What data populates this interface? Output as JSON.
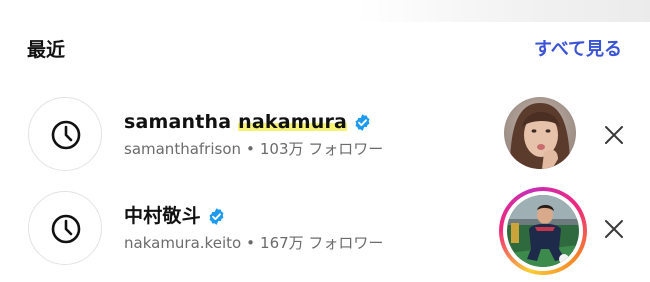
{
  "section": {
    "title": "最近",
    "see_all_label": "すべて見る"
  },
  "colors": {
    "accent_link": "#3b54d6",
    "verified_blue": "#1d9bf0",
    "secondary_text": "#6b6b6b",
    "highlight": "#f4f05a"
  },
  "recent": [
    {
      "name_part1": "samantha ",
      "name_part2": "nakamura",
      "verified": true,
      "username": "samanthafrison",
      "separator": "•",
      "followers": "103万 フォロワー",
      "icon": "clock-icon",
      "has_story_ring": false
    },
    {
      "name_part1": "中村敬斗",
      "name_part2": "",
      "verified": true,
      "username": "nakamura.keito",
      "separator": "•",
      "followers": "167万 フォロワー",
      "icon": "clock-icon",
      "has_story_ring": true
    }
  ]
}
